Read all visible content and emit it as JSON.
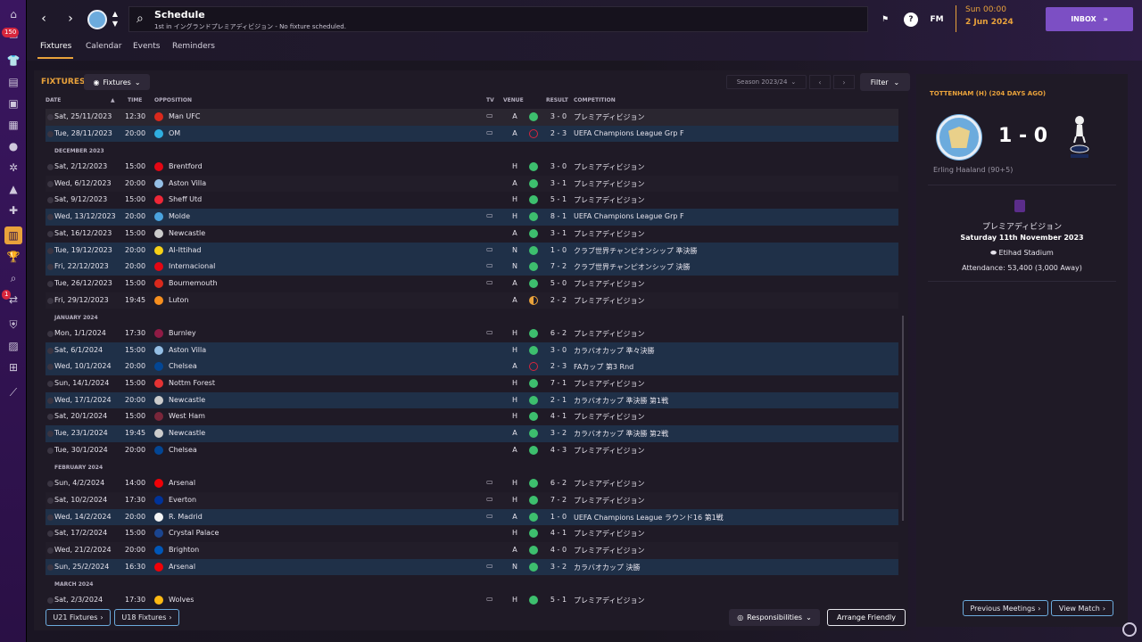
{
  "header": {
    "title": "Schedule",
    "subtitle": "1st in イングランドプレミアディビジョン - No fixture scheduled.",
    "fm_label": "FM",
    "time": "Sun 00:00",
    "date": "2 Jun 2024",
    "inbox_label": "INBOX",
    "help_label": "?"
  },
  "rail": {
    "badges": [
      "150",
      "1"
    ]
  },
  "tabs": [
    {
      "label": "Fixtures"
    },
    {
      "label": "Calendar"
    },
    {
      "label": "Events"
    },
    {
      "label": "Reminders"
    }
  ],
  "fixtures": {
    "title": "FIXTURES",
    "view_dropdown": "Fixtures",
    "season": "Season 2023/24",
    "filter_label": "Filter",
    "columns": {
      "date": "DATE",
      "time": "TIME",
      "opposition": "OPPOSITION",
      "tv": "TV",
      "venue": "VENUE",
      "result": "RESULT",
      "competition": "COMPETITION"
    },
    "rows": [
      {
        "date": "Sat, 25/11/2023",
        "time": "12:30",
        "opp": "Man UFC",
        "tv": true,
        "venue": "A",
        "res": "w",
        "score": "3 - 0",
        "comp": "プレミアディビジョン",
        "style": "grey",
        "color": "#da291c"
      },
      {
        "date": "Tue, 28/11/2023",
        "time": "20:00",
        "opp": "OM",
        "tv": true,
        "venue": "A",
        "res": "l",
        "score": "2 - 3",
        "comp": "UEFA Champions League Grp F",
        "style": "hl",
        "color": "#2faee0"
      },
      {
        "section": "DECEMBER 2023"
      },
      {
        "date": "Sat, 2/12/2023",
        "time": "15:00",
        "opp": "Brentford",
        "tv": false,
        "venue": "H",
        "res": "w",
        "score": "3 - 0",
        "comp": "プレミアディビジョン",
        "style": "",
        "color": "#e30613"
      },
      {
        "date": "Wed, 6/12/2023",
        "time": "20:00",
        "opp": "Aston Villa",
        "tv": false,
        "venue": "A",
        "res": "w",
        "score": "3 - 1",
        "comp": "プレミアディビジョン",
        "style": "alt",
        "color": "#95bfe5"
      },
      {
        "date": "Sat, 9/12/2023",
        "time": "15:00",
        "opp": "Sheff Utd",
        "tv": false,
        "venue": "H",
        "res": "w",
        "score": "5 - 1",
        "comp": "プレミアディビジョン",
        "style": "",
        "color": "#ee2737"
      },
      {
        "date": "Wed, 13/12/2023",
        "time": "20:00",
        "opp": "Molde",
        "tv": true,
        "venue": "H",
        "res": "w",
        "score": "8 - 1",
        "comp": "UEFA Champions League Grp F",
        "style": "hl",
        "color": "#4aa3df"
      },
      {
        "date": "Sat, 16/12/2023",
        "time": "15:00",
        "opp": "Newcastle",
        "tv": false,
        "venue": "A",
        "res": "w",
        "score": "3 - 1",
        "comp": "プレミアディビジョン",
        "style": "",
        "color": "#cccccc"
      },
      {
        "date": "Tue, 19/12/2023",
        "time": "20:00",
        "opp": "Al-Ittihad",
        "tv": true,
        "venue": "N",
        "res": "w",
        "score": "1 - 0",
        "comp": "クラブ世界チャンピオンシップ 準決勝",
        "style": "hl",
        "color": "#f7d117"
      },
      {
        "date": "Fri, 22/12/2023",
        "time": "20:00",
        "opp": "Internacional",
        "tv": true,
        "venue": "N",
        "res": "w",
        "score": "7 - 2",
        "comp": "クラブ世界チャンピオンシップ 決勝",
        "style": "hl",
        "color": "#e30613"
      },
      {
        "date": "Tue, 26/12/2023",
        "time": "15:00",
        "opp": "Bournemouth",
        "tv": true,
        "venue": "A",
        "res": "w",
        "score": "5 - 0",
        "comp": "プレミアディビジョン",
        "style": "",
        "color": "#da291c"
      },
      {
        "date": "Fri, 29/12/2023",
        "time": "19:45",
        "opp": "Luton",
        "tv": false,
        "venue": "A",
        "res": "d",
        "score": "2 - 2",
        "comp": "プレミアディビジョン",
        "style": "alt",
        "color": "#f78f1e"
      },
      {
        "section": "JANUARY 2024"
      },
      {
        "date": "Mon, 1/1/2024",
        "time": "17:30",
        "opp": "Burnley",
        "tv": true,
        "venue": "H",
        "res": "w",
        "score": "6 - 2",
        "comp": "プレミアディビジョン",
        "style": "",
        "color": "#8f1b45"
      },
      {
        "date": "Sat, 6/1/2024",
        "time": "15:00",
        "opp": "Aston Villa",
        "tv": false,
        "venue": "H",
        "res": "w",
        "score": "3 - 0",
        "comp": "カラバオカップ 準々決勝",
        "style": "hl",
        "color": "#95bfe5"
      },
      {
        "date": "Wed, 10/1/2024",
        "time": "20:00",
        "opp": "Chelsea",
        "tv": false,
        "venue": "A",
        "res": "l",
        "score": "2 - 3",
        "comp": "FAカップ 第3 Rnd",
        "style": "hl",
        "color": "#034694"
      },
      {
        "date": "Sun, 14/1/2024",
        "time": "15:00",
        "opp": "Nottm Forest",
        "tv": false,
        "venue": "H",
        "res": "w",
        "score": "7 - 1",
        "comp": "プレミアディビジョン",
        "style": "",
        "color": "#e53233"
      },
      {
        "date": "Wed, 17/1/2024",
        "time": "20:00",
        "opp": "Newcastle",
        "tv": false,
        "venue": "H",
        "res": "w",
        "score": "2 - 1",
        "comp": "カラバオカップ 準決勝 第1戦",
        "style": "hl",
        "color": "#cccccc"
      },
      {
        "date": "Sat, 20/1/2024",
        "time": "15:00",
        "opp": "West Ham",
        "tv": false,
        "venue": "H",
        "res": "w",
        "score": "4 - 1",
        "comp": "プレミアディビジョン",
        "style": "",
        "color": "#7a263a"
      },
      {
        "date": "Tue, 23/1/2024",
        "time": "19:45",
        "opp": "Newcastle",
        "tv": false,
        "venue": "A",
        "res": "w",
        "score": "3 - 2",
        "comp": "カラバオカップ 準決勝 第2戦",
        "style": "hl",
        "color": "#cccccc"
      },
      {
        "date": "Tue, 30/1/2024",
        "time": "20:00",
        "opp": "Chelsea",
        "tv": false,
        "venue": "A",
        "res": "w",
        "score": "4 - 3",
        "comp": "プレミアディビジョン",
        "style": "",
        "color": "#034694"
      },
      {
        "section": "FEBRUARY 2024"
      },
      {
        "date": "Sun, 4/2/2024",
        "time": "14:00",
        "opp": "Arsenal",
        "tv": true,
        "venue": "H",
        "res": "w",
        "score": "6 - 2",
        "comp": "プレミアディビジョン",
        "style": "",
        "color": "#ef0107"
      },
      {
        "date": "Sat, 10/2/2024",
        "time": "17:30",
        "opp": "Everton",
        "tv": true,
        "venue": "H",
        "res": "w",
        "score": "7 - 2",
        "comp": "プレミアディビジョン",
        "style": "alt",
        "color": "#003399"
      },
      {
        "date": "Wed, 14/2/2024",
        "time": "20:00",
        "opp": "R. Madrid",
        "tv": true,
        "venue": "A",
        "res": "w",
        "score": "1 - 0",
        "comp": "UEFA Champions League ラウンド16 第1戦",
        "style": "hl",
        "color": "#f5f5f5"
      },
      {
        "date": "Sat, 17/2/2024",
        "time": "15:00",
        "opp": "Crystal Palace",
        "tv": false,
        "venue": "H",
        "res": "w",
        "score": "4 - 1",
        "comp": "プレミアディビジョン",
        "style": "",
        "color": "#1b458f"
      },
      {
        "date": "Wed, 21/2/2024",
        "time": "20:00",
        "opp": "Brighton",
        "tv": false,
        "venue": "A",
        "res": "w",
        "score": "4 - 0",
        "comp": "プレミアディビジョン",
        "style": "alt",
        "color": "#0057b8"
      },
      {
        "date": "Sun, 25/2/2024",
        "time": "16:30",
        "opp": "Arsenal",
        "tv": true,
        "venue": "N",
        "res": "w",
        "score": "3 - 2",
        "comp": "カラバオカップ 決勝",
        "style": "hl",
        "color": "#ef0107"
      },
      {
        "section": "MARCH 2024"
      },
      {
        "date": "Sat, 2/3/2024",
        "time": "17:30",
        "opp": "Wolves",
        "tv": true,
        "venue": "H",
        "res": "w",
        "score": "5 - 1",
        "comp": "プレミアディビジョン",
        "style": "",
        "color": "#fdb913"
      }
    ],
    "u21_label": "U21 Fixtures",
    "u18_label": "U18 Fixtures",
    "responsibilities_label": "Responsibilities",
    "arrange_label": "Arrange Friendly"
  },
  "sidebar": {
    "title": "TOTTENHAM (H) (204 DAYS AGO)",
    "score": "1 - 0",
    "scorer": "Erling Haaland (90+5)",
    "competition": "プレミアディビジョン",
    "date": "Saturday 11th November 2023",
    "stadium": "Etihad Stadium",
    "attendance": "Attendance: 53,400 (3,000 Away)",
    "prev_label": "Previous Meetings",
    "view_label": "View Match"
  },
  "colors": {
    "win": "#3dbf6e",
    "loss": "#d7263d",
    "draw": "#e9a23b",
    "accent": "#e9a23b",
    "inbox": "#7c4fc4",
    "link": "#6cabdd"
  }
}
